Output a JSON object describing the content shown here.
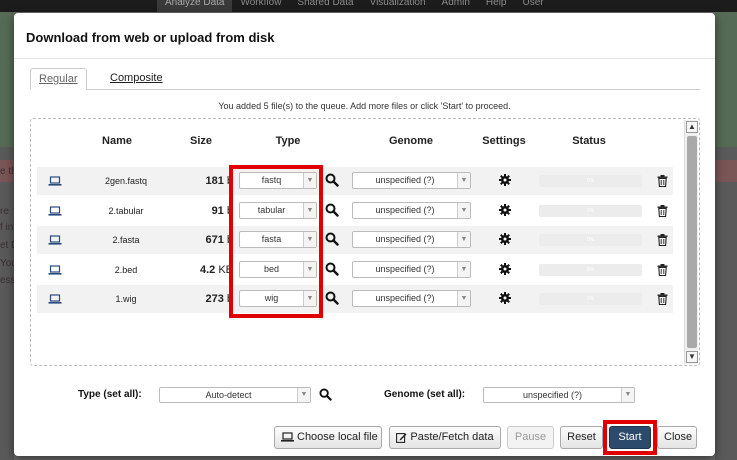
{
  "background": {
    "nav": [
      "Analyze Data",
      "Workflow",
      "Shared Data",
      "Visualization",
      "Admin",
      "Help",
      "User"
    ],
    "left_fragments": [
      "re",
      "f in",
      "et D",
      "You",
      "ess"
    ],
    "right_fragments": [
      "e th"
    ]
  },
  "modal": {
    "title": "Download from web or upload from disk",
    "tabs": [
      {
        "label": "Regular",
        "active": true
      },
      {
        "label": "Composite",
        "active": false
      }
    ],
    "queue_message": "You added 5 file(s) to the queue. Add more files or click 'Start' to proceed."
  },
  "table": {
    "headers": {
      "name": "Name",
      "size": "Size",
      "type": "Type",
      "genome": "Genome",
      "settings": "Settings",
      "status": "Status"
    },
    "rows": [
      {
        "name": "2gen.fastq",
        "size_value": "181",
        "size_unit": "b",
        "type": "fastq",
        "genome": "unspecified (?)",
        "status": "0%"
      },
      {
        "name": "2.tabular",
        "size_value": "91",
        "size_unit": "b",
        "type": "tabular",
        "genome": "unspecified (?)",
        "status": "0%"
      },
      {
        "name": "2.fasta",
        "size_value": "671",
        "size_unit": "b",
        "type": "fasta",
        "genome": "unspecified (?)",
        "status": "0%"
      },
      {
        "name": "2.bed",
        "size_value": "4.2",
        "size_unit": "KB",
        "type": "bed",
        "genome": "unspecified (?)",
        "status": "0%"
      },
      {
        "name": "1.wig",
        "size_value": "273",
        "size_unit": "b",
        "type": "wig",
        "genome": "unspecified (?)",
        "status": "0%"
      }
    ]
  },
  "set_all": {
    "type_label": "Type (set all):",
    "type_value": "Auto-detect",
    "genome_label": "Genome (set all):",
    "genome_value": "unspecified (?)"
  },
  "buttons": {
    "choose_local": "Choose local file",
    "paste_fetch": "Paste/Fetch data",
    "pause": "Pause",
    "reset": "Reset",
    "start": "Start",
    "close": "Close"
  },
  "icons": {
    "laptop": "laptop-icon",
    "search": "search-icon",
    "gear": "gear-icon",
    "trash": "trash-icon",
    "edit": "edit-icon"
  },
  "colors": {
    "highlight": "#e00000",
    "primary_button": "#2c4a6b"
  }
}
